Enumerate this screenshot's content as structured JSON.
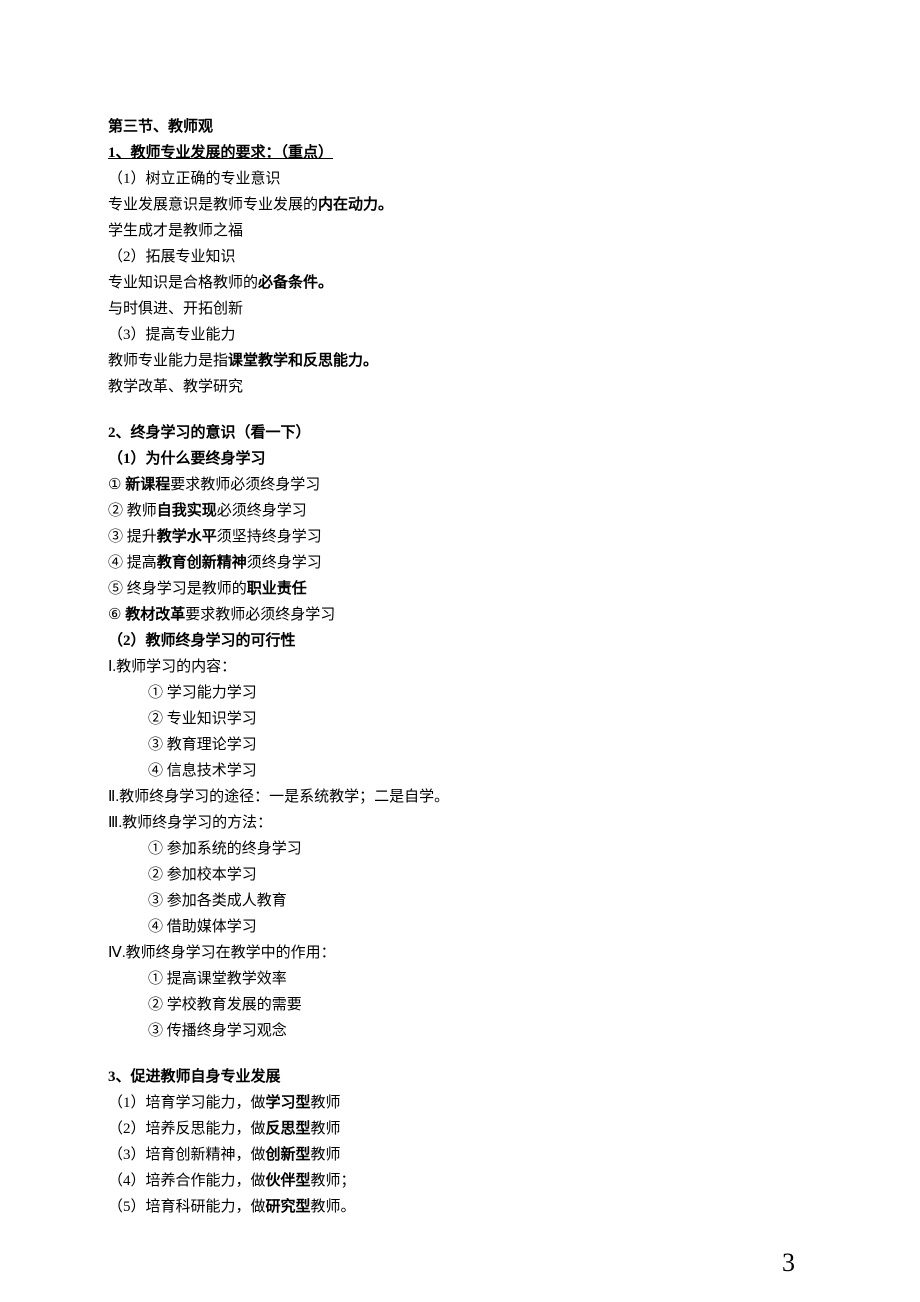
{
  "section_title": "第三节、教师观",
  "h1": {
    "num": "1、",
    "title": "教师专业发展的要求：（重点）"
  },
  "s1": {
    "l1": "（1）树立正确的专业意识",
    "l2a": "专业发展意识是教师专业发展的",
    "l2b": "内在动力。",
    "l3": "学生成才是教师之福",
    "l4": "（2）拓展专业知识",
    "l5a": "专业知识是合格教师的",
    "l5b": "必备条件。",
    "l6": "与时俱进、开拓创新",
    "l7": "（3）提高专业能力",
    "l8a": "教师专业能力是指",
    "l8b": "课堂教学和反思能力。",
    "l9": "教学改革、教学研究"
  },
  "h2": "2、终身学习的意识（看一下）",
  "s2": {
    "sub1": "（1）为什么要终身学习",
    "i1a": "① ",
    "i1b": "新课程",
    "i1c": "要求教师必须终身学习",
    "i2a": "② 教师",
    "i2b": "自我实现",
    "i2c": "必须终身学习",
    "i3a": "③ 提升",
    "i3b": "教学水平",
    "i3c": "须坚持终身学习",
    "i4a": "④ 提高",
    "i4b": "教育创新精神",
    "i4c": "须终身学习",
    "i5a": "⑤ 终身学习是教师的",
    "i5b": "职业责任",
    "i6a": "⑥ ",
    "i6b": "教材改革",
    "i6c": "要求教师必须终身学习",
    "sub2": "（2）教师终身学习的可行性",
    "r1": "Ⅰ.教师学习的内容：",
    "r1_1": "① 学习能力学习",
    "r1_2": "② 专业知识学习",
    "r1_3": "③ 教育理论学习",
    "r1_4": "④ 信息技术学习",
    "r2": "Ⅱ.教师终身学习的途径：一是系统教学；二是自学。",
    "r3": "Ⅲ.教师终身学习的方法：",
    "r3_1": "① 参加系统的终身学习",
    "r3_2": "② 参加校本学习",
    "r3_3": "③ 参加各类成人教育",
    "r3_4": "④ 借助媒体学习",
    "r4": "Ⅳ.教师终身学习在教学中的作用：",
    "r4_1": "① 提高课堂教学效率",
    "r4_2": "② 学校教育发展的需要",
    "r4_3": "③ 传播终身学习观念"
  },
  "h3": "3、促进教师自身专业发展",
  "s3": {
    "l1a": "（1）培育学习能力，做",
    "l1b": "学习型",
    "l1c": "教师",
    "l2a": "（2）培养反思能力，做",
    "l2b": "反思型",
    "l2c": "教师",
    "l3a": "（3）培育创新精神，做",
    "l3b": "创新型",
    "l3c": "教师",
    "l4a": "（4）培养合作能力，做",
    "l4b": "伙伴型",
    "l4c": "教师；",
    "l5a": "（5）培育科研能力，做",
    "l5b": "研究型",
    "l5c": "教师。"
  },
  "page_number": "3"
}
